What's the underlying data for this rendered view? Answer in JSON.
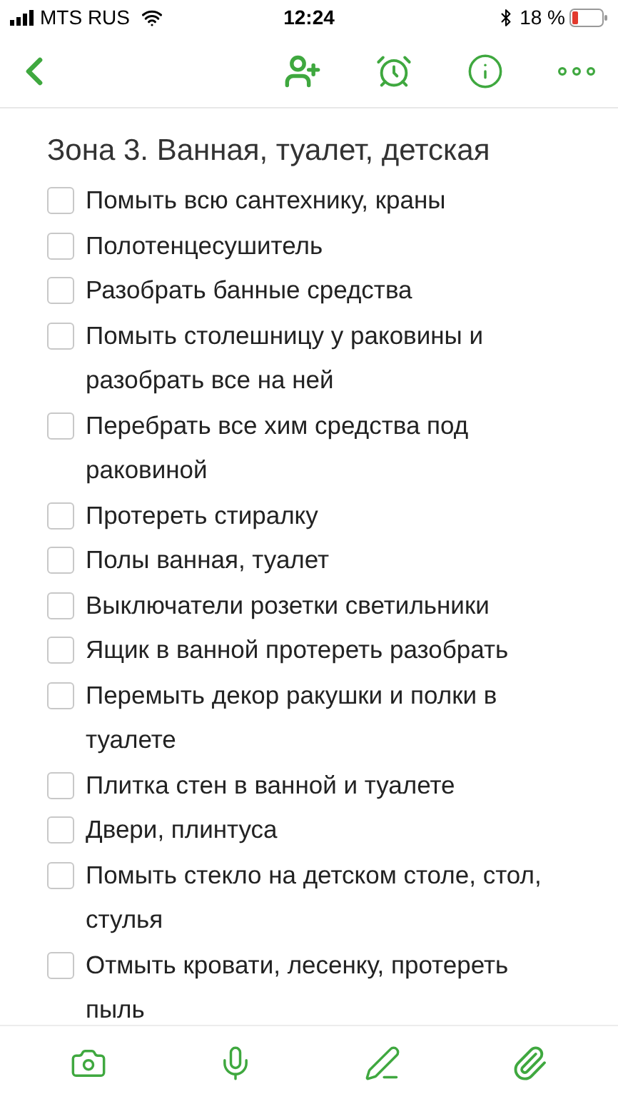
{
  "status_bar": {
    "carrier": "MTS RUS",
    "time": "12:24",
    "battery_text": "18 %"
  },
  "note": {
    "title": "Зона 3. Ванная, туалет, детская",
    "items": [
      {
        "text": "Помыть всю сантехнику, краны",
        "checked": false
      },
      {
        "text": "Полотенцесушитель",
        "checked": false
      },
      {
        "text": "Разобрать банные средства",
        "checked": false
      },
      {
        "text": "Помыть столешницу у раковины и разобрать все на ней",
        "checked": false
      },
      {
        "text": "Перебрать все хим средства под раковиной",
        "checked": false
      },
      {
        "text": "Протереть стиралку",
        "checked": false
      },
      {
        "text": "Полы ванная, туалет",
        "checked": false
      },
      {
        "text": "Выключатели розетки светильники",
        "checked": false
      },
      {
        "text": "Ящик в ванной протереть разобрать",
        "checked": false
      },
      {
        "text": "Перемыть декор ракушки и полки в туалете",
        "checked": false
      },
      {
        "text": "Плитка стен в ванной и туалете",
        "checked": false
      },
      {
        "text": "Двери, плинтуса",
        "checked": false
      },
      {
        "text": "Помыть стекло на детском столе, стол, стулья",
        "checked": false
      },
      {
        "text": "Отмыть кровати, лесенку, протереть пыль",
        "checked": false
      }
    ]
  }
}
